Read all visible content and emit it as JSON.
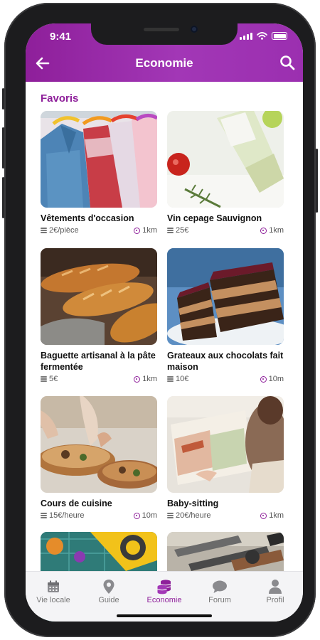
{
  "status": {
    "time": "9:41"
  },
  "header": {
    "title": "Economie"
  },
  "section": {
    "title": "Favoris"
  },
  "cards": [
    {
      "name": "Vêtements d'occasion",
      "price": "2€/pièce",
      "distance": "1km"
    },
    {
      "name": "Vin cepage Sauvignon",
      "price": "25€",
      "distance": "1km"
    },
    {
      "name": "Baguette artisanal à la pâte fermentée",
      "price": "5€",
      "distance": "1km"
    },
    {
      "name": "Grateaux aux chocolats fait maison",
      "price": "10€",
      "distance": "10m"
    },
    {
      "name": "Cours de cuisine",
      "price": "15€/heure",
      "distance": "10m"
    },
    {
      "name": "Baby-sitting",
      "price": "20€/heure",
      "distance": "1km"
    },
    {
      "name": "",
      "price": "",
      "distance": ""
    },
    {
      "name": "",
      "price": "",
      "distance": ""
    }
  ],
  "tabs": [
    {
      "label": "Vie locale",
      "icon": "calendar-icon"
    },
    {
      "label": "Guide",
      "icon": "map-pin-icon"
    },
    {
      "label": "Economie",
      "icon": "coins-icon",
      "active": true
    },
    {
      "label": "Forum",
      "icon": "chat-icon"
    },
    {
      "label": "Profil",
      "icon": "person-icon"
    }
  ],
  "colors": {
    "accent": "#8e1f9a",
    "header_start": "#8e1f9a",
    "header_end": "#a237b6"
  }
}
